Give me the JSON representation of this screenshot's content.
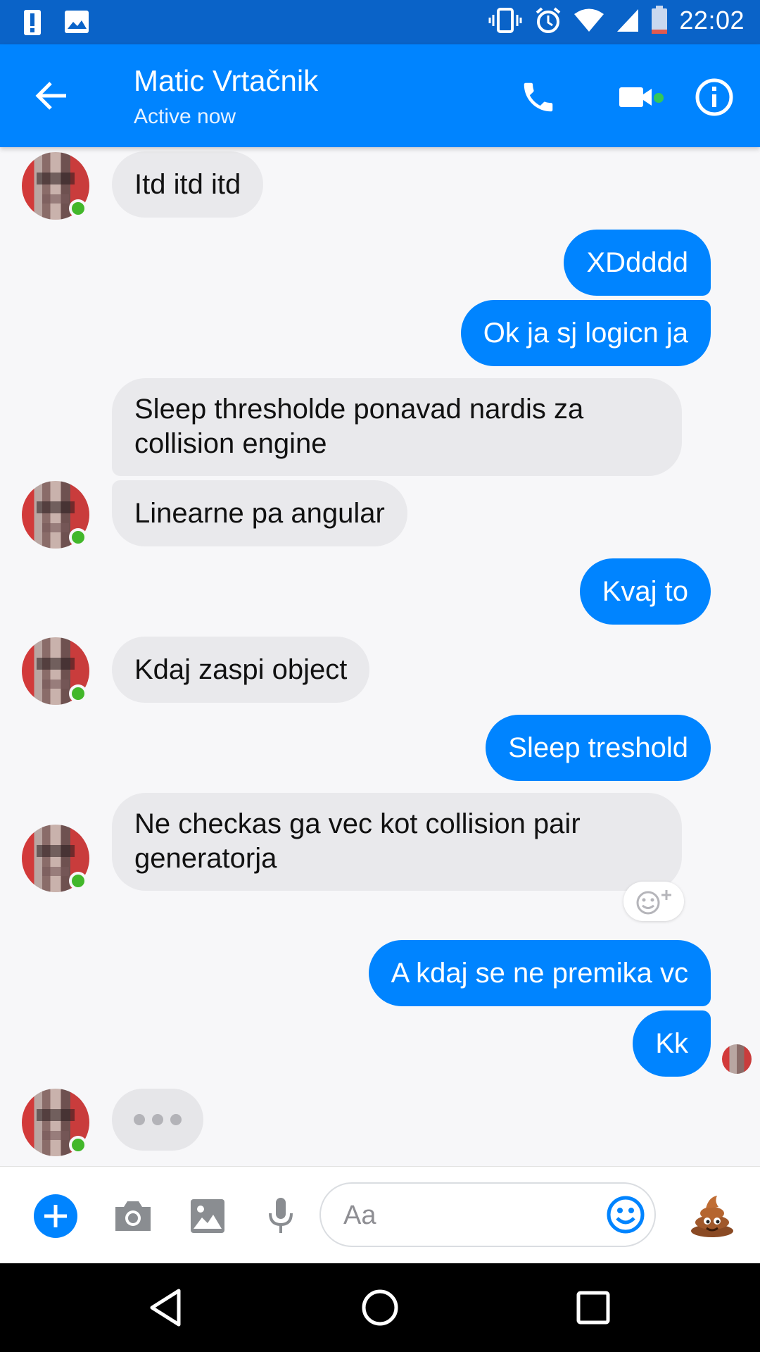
{
  "status_bar": {
    "time": "22:02"
  },
  "header": {
    "name": "Matic Vrtačnik",
    "status": "Active now"
  },
  "messages": [
    {
      "dir": "in",
      "text": "Itd itd itd"
    },
    {
      "dir": "out",
      "text": "XDdddd"
    },
    {
      "dir": "out",
      "text": "Ok ja sj logicn ja"
    },
    {
      "dir": "in",
      "text": "Sleep thresholde ponavad nardis za collision engine"
    },
    {
      "dir": "in",
      "text": "Linearne pa angular"
    },
    {
      "dir": "out",
      "text": "Kvaj to"
    },
    {
      "dir": "in",
      "text": "Kdaj zaspi object"
    },
    {
      "dir": "out",
      "text": "Sleep treshold"
    },
    {
      "dir": "in",
      "text": "Ne checkas ga vec kot collision pair generatorja"
    },
    {
      "dir": "out",
      "text": "A kdaj se ne premika vc"
    },
    {
      "dir": "out",
      "text": "Kk"
    }
  ],
  "composer": {
    "placeholder": "Aa"
  },
  "icons": {
    "accent": "#0084ff",
    "online": "#42b72a",
    "like_emoji": "💩"
  }
}
